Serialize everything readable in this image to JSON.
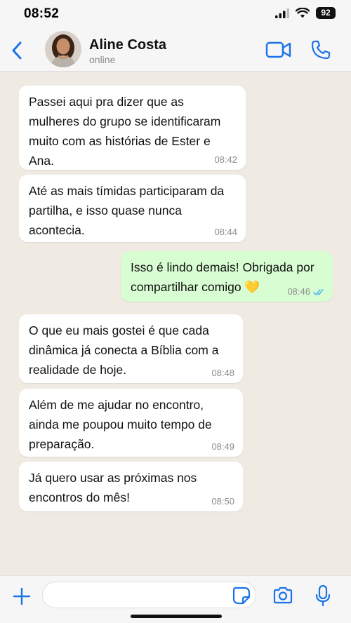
{
  "status_bar": {
    "time": "08:52",
    "battery": "92"
  },
  "header": {
    "contact_name": "Aline Costa",
    "contact_status": "online"
  },
  "messages": [
    {
      "direction": "incoming",
      "text": "Passei aqui pra dizer que as mulheres do grupo se identificaram muito com as histórias de Ester e Ana.",
      "time": "08:42"
    },
    {
      "direction": "incoming",
      "text": "Até as mais tímidas participaram da partilha, e isso quase nunca acontecia.",
      "time": "08:44"
    },
    {
      "direction": "outgoing",
      "text": "Isso é lindo demais! Obrigada por compartilhar comigo 💛",
      "time": "08:46",
      "read": true
    },
    {
      "direction": "incoming",
      "text": "O que eu mais gostei é que cada dinâmica já conecta a Bíblia com a realidade de hoje.",
      "time": "08:48"
    },
    {
      "direction": "incoming",
      "text": "Além de me ajudar no encontro, ainda me poupou muito tempo de preparação.",
      "time": "08:49"
    },
    {
      "direction": "incoming",
      "text": "Já quero usar as próximas nos encontros do mês!",
      "time": "08:50"
    }
  ],
  "composer": {
    "value": "",
    "placeholder": ""
  },
  "icons": {
    "back": "chevron-left-icon",
    "video": "video-camera-icon",
    "call": "phone-icon",
    "plus": "plus-icon",
    "sticker": "sticker-icon",
    "camera": "camera-icon",
    "mic": "microphone-icon"
  },
  "colors": {
    "accent": "#1a73e8",
    "incoming_bubble": "#ffffff",
    "outgoing_bubble": "#d9fdd3",
    "read_ticks": "#53bdeb",
    "chat_background": "#efeae2"
  }
}
